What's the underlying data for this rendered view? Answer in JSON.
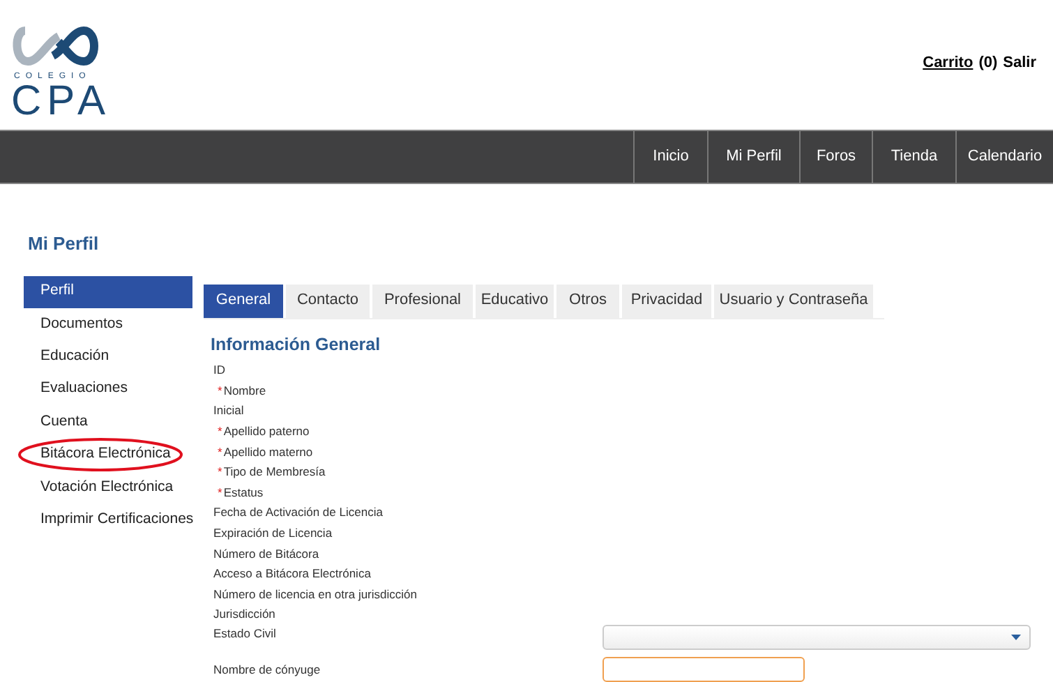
{
  "logo": {
    "small": "COLEGIO",
    "large": "CPA"
  },
  "header_links": [
    {
      "label": "Carrito",
      "underlined": true
    },
    {
      "label": "(0)",
      "underlined": false
    },
    {
      "label": "Salir",
      "underlined": false
    }
  ],
  "nav": [
    "Inicio",
    "Mi Perfil",
    "Foros",
    "Tienda",
    "Calendario"
  ],
  "page_title": "Mi Perfil",
  "sidebar": [
    {
      "label": "Perfil",
      "selected": true,
      "circled": false
    },
    {
      "label": "Documentos",
      "selected": false,
      "circled": false
    },
    {
      "label": "Educación",
      "selected": false,
      "circled": false
    },
    {
      "label": "Evaluaciones",
      "selected": false,
      "circled": false
    },
    {
      "label": "Cuenta",
      "selected": false,
      "circled": false
    },
    {
      "label": "Bitácora Electrónica",
      "selected": false,
      "circled": true
    },
    {
      "label": "Votación Electrónica",
      "selected": false,
      "circled": false
    },
    {
      "label": "Imprimir Certificaciones",
      "selected": false,
      "circled": false
    }
  ],
  "tabs": [
    {
      "label": "General",
      "selected": true
    },
    {
      "label": "Contacto",
      "selected": false
    },
    {
      "label": "Profesional",
      "selected": false
    },
    {
      "label": "Educativo",
      "selected": false
    },
    {
      "label": "Otros",
      "selected": false
    },
    {
      "label": "Privacidad",
      "selected": false
    },
    {
      "label": "Usuario y Contraseña",
      "selected": false
    }
  ],
  "section_title": "Información General",
  "fields": [
    {
      "label": "ID",
      "kind": "text"
    },
    {
      "label": "Nombre",
      "required_mark": "*",
      "kind": "text"
    },
    {
      "label": "Inicial",
      "kind": "text"
    },
    {
      "label": "Apellido paterno",
      "required_mark": "*",
      "kind": "text"
    },
    {
      "label": "Apellido materno",
      "required_mark": "*",
      "kind": "text"
    },
    {
      "label": "Tipo de Membresía",
      "required_mark": "*",
      "kind": "text"
    },
    {
      "label": "Estatus",
      "required_mark": "*",
      "kind": "text"
    },
    {
      "label": "Fecha de Activación de Licencia",
      "kind": "text"
    },
    {
      "label": "Expiración de Licencia",
      "kind": "text"
    },
    {
      "label": "Número de Bitácora",
      "kind": "text"
    },
    {
      "label": "Acceso a Bitácora Electrónica",
      "kind": "text"
    },
    {
      "label": "Número de licencia en otra jurisdicción",
      "kind": "text"
    },
    {
      "label": "Jurisdicción",
      "kind": "text"
    },
    {
      "label": "Estado Civil",
      "kind": "select"
    },
    {
      "label": "Nombre de cónyuge",
      "kind": "input",
      "focused": true
    }
  ]
}
